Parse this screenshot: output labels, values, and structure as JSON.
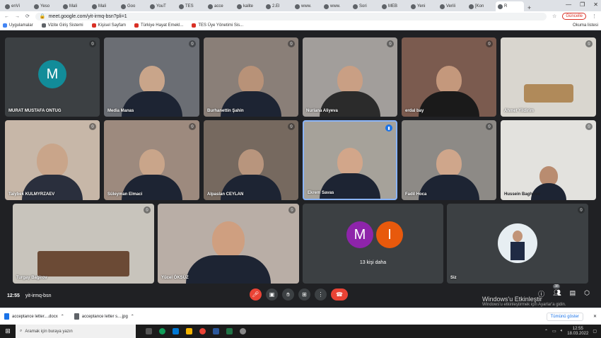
{
  "browser": {
    "tabs": [
      {
        "label": "enVi"
      },
      {
        "label": "Yeso"
      },
      {
        "label": "Mali"
      },
      {
        "label": "Mali"
      },
      {
        "label": "Goo"
      },
      {
        "label": "YouT"
      },
      {
        "label": "TES"
      },
      {
        "label": "acce"
      },
      {
        "label": "kalite"
      },
      {
        "label": "2.El"
      },
      {
        "label": "www."
      },
      {
        "label": "www."
      },
      {
        "label": "Sori"
      },
      {
        "label": "MEB"
      },
      {
        "label": "Yeni"
      },
      {
        "label": "Verili"
      },
      {
        "label": "[Kon"
      },
      {
        "label": "R"
      }
    ],
    "new_tab": "+",
    "window_controls": [
      "—",
      "❐",
      "✕"
    ],
    "url": "meet.google.com/yit-irmq-bsn?pli=1",
    "update_label": "Güncelle",
    "bookmarks": [
      {
        "label": "Uygulamalar",
        "color": "#4285f4"
      },
      {
        "label": "Vizite Giriş Sistemi",
        "color": "#5f6368"
      },
      {
        "label": "Kişisel Sayfam",
        "color": "#d93025"
      },
      {
        "label": "Türkiye Hayat Emekl...",
        "color": "#d93025"
      },
      {
        "label": "TES Üye Yönetimi Sis...",
        "color": "#d93025"
      }
    ],
    "reading_list": "Okuma listesi"
  },
  "meet": {
    "participants": [
      {
        "name": "MURAT MUSTAFA ONTUG",
        "initial": "M"
      },
      {
        "name": "Media Manas"
      },
      {
        "name": "Burhanettin Şahin"
      },
      {
        "name": "Nurlana Aliyeva"
      },
      {
        "name": "erdal bay"
      },
      {
        "name": "Ahmet Yildirim"
      },
      {
        "name": "Taiybek KULMYRZAEV"
      },
      {
        "name": "Süleyman Elmaci"
      },
      {
        "name": "Alpaslan CEYLAN"
      },
      {
        "name": "Ekrem Savas"
      },
      {
        "name": "Fadil Hoca"
      },
      {
        "name": "Hussein Baghirov"
      },
      {
        "name": "Turgay Bagirov"
      },
      {
        "name": "Yücel ÖKSÜZ"
      }
    ],
    "more": {
      "label": "13 kişi daha",
      "initials": [
        "M",
        "I"
      ],
      "colors": [
        "#8e24aa",
        "#e8590c"
      ]
    },
    "self_label": "Siz",
    "time": "12:55",
    "meeting_code": "yit-irmq-bsn",
    "participant_count": "38"
  },
  "windows_notice": {
    "title": "Windows'u Etkinleştir",
    "subtitle": "Windows'u etkinleştirmek için Ayarlar'a gidin."
  },
  "downloads": {
    "items": [
      "acceptance letter....docx",
      "acceptance letter s....jpg"
    ],
    "show_all": "Tümünü göster"
  },
  "taskbar": {
    "search_placeholder": "Aramak için buraya yazın",
    "clock_time": "12:55",
    "clock_date": "18.03.2022"
  }
}
